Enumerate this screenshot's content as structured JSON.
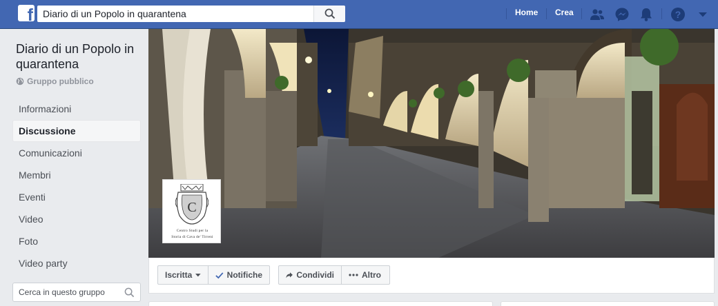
{
  "topbar": {
    "logo_letter": "f",
    "search_value": "Diario di un Popolo in quarantena",
    "home_label": "Home",
    "create_label": "Crea",
    "icons": [
      "friends-icon",
      "messenger-icon",
      "notifications-icon",
      "help-icon",
      "account-menu-icon"
    ]
  },
  "group": {
    "name": "Diario di un Popolo in quarantena",
    "privacy": "Gruppo pubblico"
  },
  "sidebar": {
    "items": [
      {
        "label": "Informazioni",
        "active": false
      },
      {
        "label": "Discussione",
        "active": true
      },
      {
        "label": "Comunicazioni",
        "active": false
      },
      {
        "label": "Membri",
        "active": false
      },
      {
        "label": "Eventi",
        "active": false
      },
      {
        "label": "Video",
        "active": false
      },
      {
        "label": "Foto",
        "active": false
      },
      {
        "label": "Video party",
        "active": false
      }
    ],
    "search_placeholder": "Cerca in questo gruppo"
  },
  "cover": {
    "logo_caption_line1": "Centro Studi per la",
    "logo_caption_line2": "Storia di Cava de' Tirreni"
  },
  "actions": {
    "joined_label": "Iscritta",
    "notifications_label": "Notifiche",
    "share_label": "Condividi",
    "more_label": "Altro"
  },
  "colors": {
    "brand": "#4267b2",
    "page_bg": "#e9ebee",
    "link_blue": "#4267b2"
  }
}
